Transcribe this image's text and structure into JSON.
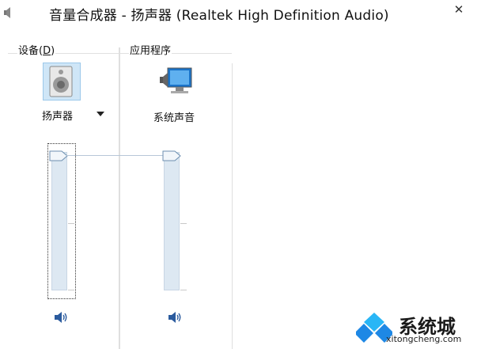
{
  "window": {
    "title": "音量合成器 - 扬声器 (Realtek High Definition Audio)",
    "close_label": "✕"
  },
  "device_group": {
    "label": "设备",
    "mnemonic_open": "(",
    "mnemonic": "D",
    "mnemonic_close": ")",
    "device_name": "扬声器",
    "icon": "speaker-device-icon",
    "volume_level": 1.0,
    "mute_icon": "speaker-volume-icon"
  },
  "apps_group": {
    "label": "应用程序",
    "apps": [
      {
        "name": "系统声音",
        "icon": "system-sounds-icon",
        "volume_level": 1.0,
        "mute_icon": "speaker-volume-icon"
      }
    ]
  },
  "watermark": {
    "brand": "系统城",
    "url": "xitongcheng.com",
    "logo": "windows-logo-icon",
    "colors": [
      "#1e88e5",
      "#29b6f6"
    ]
  }
}
